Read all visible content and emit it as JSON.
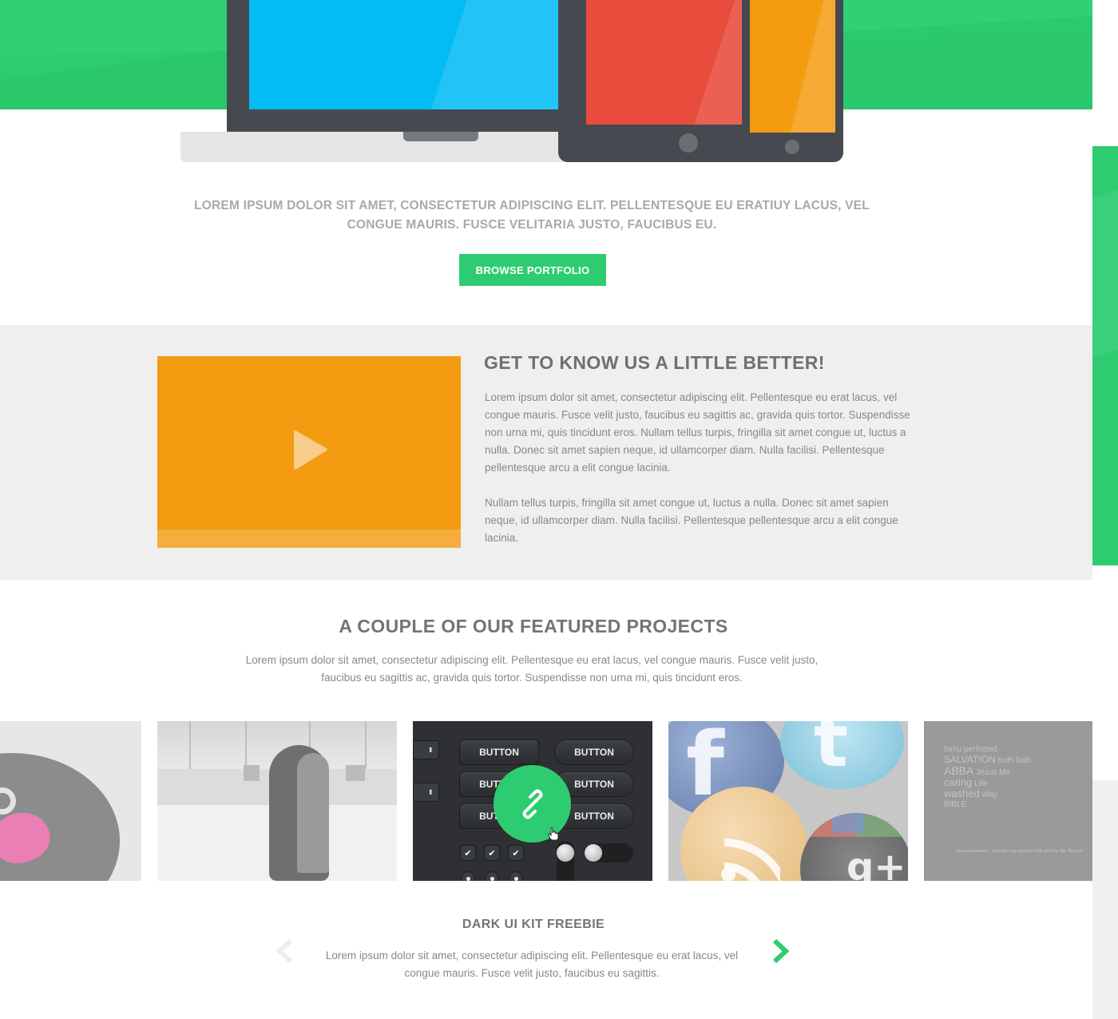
{
  "hero": {
    "intro": "LOREM IPSUM DOLOR SIT AMET, CONSECTETUR ADIPISCING ELIT. PELLENTESQUE EU ERATIUY LACUS, VEL CONGUE MAURIS. FUSCE VELITARIA JUSTO, FAUCIBUS EU.",
    "browse_button": "BROWSE PORTFOLIO"
  },
  "about": {
    "title": "GET TO KNOW US A LITTLE BETTER!",
    "paragraph1": "Lorem ipsum dolor sit amet, consectetur adipiscing elit. Pellentesque eu erat lacus, vel congue mauris. Fusce velit justo, faucibus eu sagittis ac, gravida quis tortor. Suspendisse non urna mi, quis tincidunt eros. Nullam tellus turpis, fringilla sit amet congue ut, luctus a nulla. Donec sit amet sapien neque, id ullamcorper diam. Nulla facilisi. Pellentesque pellentesque arcu a elit congue lacinia.",
    "paragraph2": "Nullam tellus turpis, fringilla sit amet congue ut, luctus a nulla. Donec sit amet sapien neque, id ullamcorper diam. Nulla facilisi. Pellentesque pellentesque arcu a elit congue lacinia.",
    "video_icon": "play-icon"
  },
  "featured": {
    "title": "A COUPLE OF OUR FEATURED PROJECTS",
    "description": "Lorem ipsum dolor sit amet, consectetur adipiscing elit. Pellentesque eu erat lacus, vel congue mauris. Fusce velit justo, faucibus eu sagittis ac, gravida quis tortor. Suspendisse non urna mi, quis tincidunt eros.",
    "ui_kit_buttons": [
      "BUTTON",
      "BUTTON",
      "BUTTON",
      "BUTTON",
      "BUTTON",
      "BUTTON"
    ],
    "overlay_icon": "link-icon",
    "word_cloud": [
      "tamu",
      "perfected",
      "SALVATION",
      "truth",
      "faith",
      "ABBA",
      "BIBLE",
      "caring",
      "washed",
      "Jesus",
      "Me",
      "Life",
      "Way"
    ],
    "quote": "Jesus answered, ' I am the way and the truth and the life. No one'"
  },
  "current_project": {
    "title": "DARK UI KIT FREEBIE",
    "description": "Lorem ipsum dolor sit amet, consectetur adipiscing elit. Pellentesque eu erat lacus, vel congue mauris. Fusce velit justo, faucibus eu sagittis.",
    "prev_icon": "chevron-left-icon",
    "next_icon": "chevron-right-icon"
  },
  "colors": {
    "brand_green": "#2ecc71",
    "blue": "#04bcf4",
    "red": "#e84c3d",
    "orange": "#f39c12",
    "dark": "#464a50",
    "section_gray": "#efefef"
  }
}
